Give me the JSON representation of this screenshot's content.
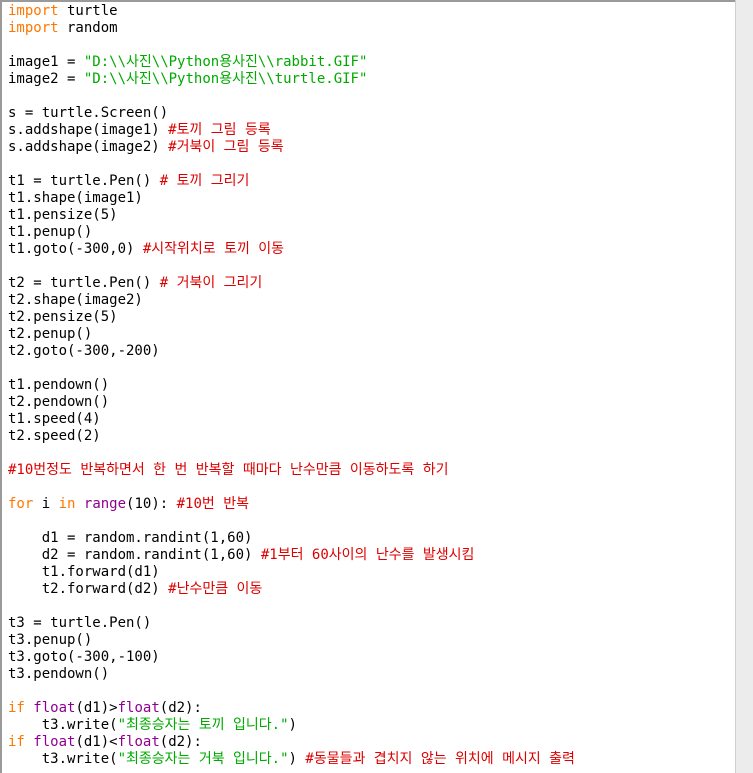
{
  "colors": {
    "keyword": "#ff7700",
    "builtin": "#900090",
    "string": "#00aa00",
    "comment": "#dd0000",
    "default": "#000000",
    "background": "#ffffff"
  },
  "code_lines": [
    [
      {
        "t": "import",
        "c": "keyword"
      },
      {
        "t": " turtle",
        "c": "default"
      }
    ],
    [
      {
        "t": "import",
        "c": "keyword"
      },
      {
        "t": " random",
        "c": "default"
      }
    ],
    [],
    [
      {
        "t": "image1 = ",
        "c": "default"
      },
      {
        "t": "\"D:\\\\사진\\\\Python용사진\\\\rabbit.GIF\"",
        "c": "string"
      }
    ],
    [
      {
        "t": "image2 = ",
        "c": "default"
      },
      {
        "t": "\"D:\\\\사진\\\\Python용사진\\\\turtle.GIF\"",
        "c": "string"
      }
    ],
    [],
    [
      {
        "t": "s = turtle.Screen()",
        "c": "default"
      }
    ],
    [
      {
        "t": "s.addshape(image1) ",
        "c": "default"
      },
      {
        "t": "#토끼 그림 등록",
        "c": "comment"
      }
    ],
    [
      {
        "t": "s.addshape(image2) ",
        "c": "default"
      },
      {
        "t": "#거북이 그림 등록",
        "c": "comment"
      }
    ],
    [],
    [
      {
        "t": "t1 = turtle.Pen() ",
        "c": "default"
      },
      {
        "t": "# 토끼 그리기",
        "c": "comment"
      }
    ],
    [
      {
        "t": "t1.shape(image1)",
        "c": "default"
      }
    ],
    [
      {
        "t": "t1.pensize(5)",
        "c": "default"
      }
    ],
    [
      {
        "t": "t1.penup()",
        "c": "default"
      }
    ],
    [
      {
        "t": "t1.goto(-300,0) ",
        "c": "default"
      },
      {
        "t": "#시작위치로 토끼 이동",
        "c": "comment"
      }
    ],
    [],
    [
      {
        "t": "t2 = turtle.Pen() ",
        "c": "default"
      },
      {
        "t": "# 거북이 그리기",
        "c": "comment"
      }
    ],
    [
      {
        "t": "t2.shape(image2)",
        "c": "default"
      }
    ],
    [
      {
        "t": "t2.pensize(5)",
        "c": "default"
      }
    ],
    [
      {
        "t": "t2.penup()",
        "c": "default"
      }
    ],
    [
      {
        "t": "t2.goto(-300,-200)",
        "c": "default"
      }
    ],
    [],
    [
      {
        "t": "t1.pendown()",
        "c": "default"
      }
    ],
    [
      {
        "t": "t2.pendown()",
        "c": "default"
      }
    ],
    [
      {
        "t": "t1.speed(4)",
        "c": "default"
      }
    ],
    [
      {
        "t": "t2.speed(2)",
        "c": "default"
      }
    ],
    [],
    [
      {
        "t": "#10번정도 반복하면서 한 번 반복할 때마다 난수만큼 이동하도록 하기",
        "c": "comment"
      }
    ],
    [],
    [
      {
        "t": "for",
        "c": "keyword"
      },
      {
        "t": " i ",
        "c": "default"
      },
      {
        "t": "in",
        "c": "keyword"
      },
      {
        "t": " ",
        "c": "default"
      },
      {
        "t": "range",
        "c": "builtin"
      },
      {
        "t": "(10): ",
        "c": "default"
      },
      {
        "t": "#10번 반복",
        "c": "comment"
      }
    ],
    [],
    [
      {
        "t": "    d1 = random.randint(1,60)",
        "c": "default"
      }
    ],
    [
      {
        "t": "    d2 = random.randint(1,60) ",
        "c": "default"
      },
      {
        "t": "#1부터 60사이의 난수를 발생시킴",
        "c": "comment"
      }
    ],
    [
      {
        "t": "    t1.forward(d1)",
        "c": "default"
      }
    ],
    [
      {
        "t": "    t2.forward(d2) ",
        "c": "default"
      },
      {
        "t": "#난수만큼 이동",
        "c": "comment"
      }
    ],
    [],
    [
      {
        "t": "t3 = turtle.Pen()",
        "c": "default"
      }
    ],
    [
      {
        "t": "t3.penup()",
        "c": "default"
      }
    ],
    [
      {
        "t": "t3.goto(-300,-100)",
        "c": "default"
      }
    ],
    [
      {
        "t": "t3.pendown()",
        "c": "default"
      }
    ],
    [],
    [
      {
        "t": "if",
        "c": "keyword"
      },
      {
        "t": " ",
        "c": "default"
      },
      {
        "t": "float",
        "c": "builtin"
      },
      {
        "t": "(d1)>",
        "c": "default"
      },
      {
        "t": "float",
        "c": "builtin"
      },
      {
        "t": "(d2):",
        "c": "default"
      }
    ],
    [
      {
        "t": "    t3.write(",
        "c": "default"
      },
      {
        "t": "\"최종승자는 토끼 입니다.\"",
        "c": "string"
      },
      {
        "t": ")",
        "c": "default"
      }
    ],
    [
      {
        "t": "if",
        "c": "keyword"
      },
      {
        "t": " ",
        "c": "default"
      },
      {
        "t": "float",
        "c": "builtin"
      },
      {
        "t": "(d1)<",
        "c": "default"
      },
      {
        "t": "float",
        "c": "builtin"
      },
      {
        "t": "(d2):",
        "c": "default"
      }
    ],
    [
      {
        "t": "    t3.write(",
        "c": "default"
      },
      {
        "t": "\"최종승자는 거북 입니다.\"",
        "c": "string"
      },
      {
        "t": ") ",
        "c": "default"
      },
      {
        "t": "#동물들과 겹치지 않는 위치에 메시지 출력",
        "c": "comment"
      }
    ]
  ]
}
